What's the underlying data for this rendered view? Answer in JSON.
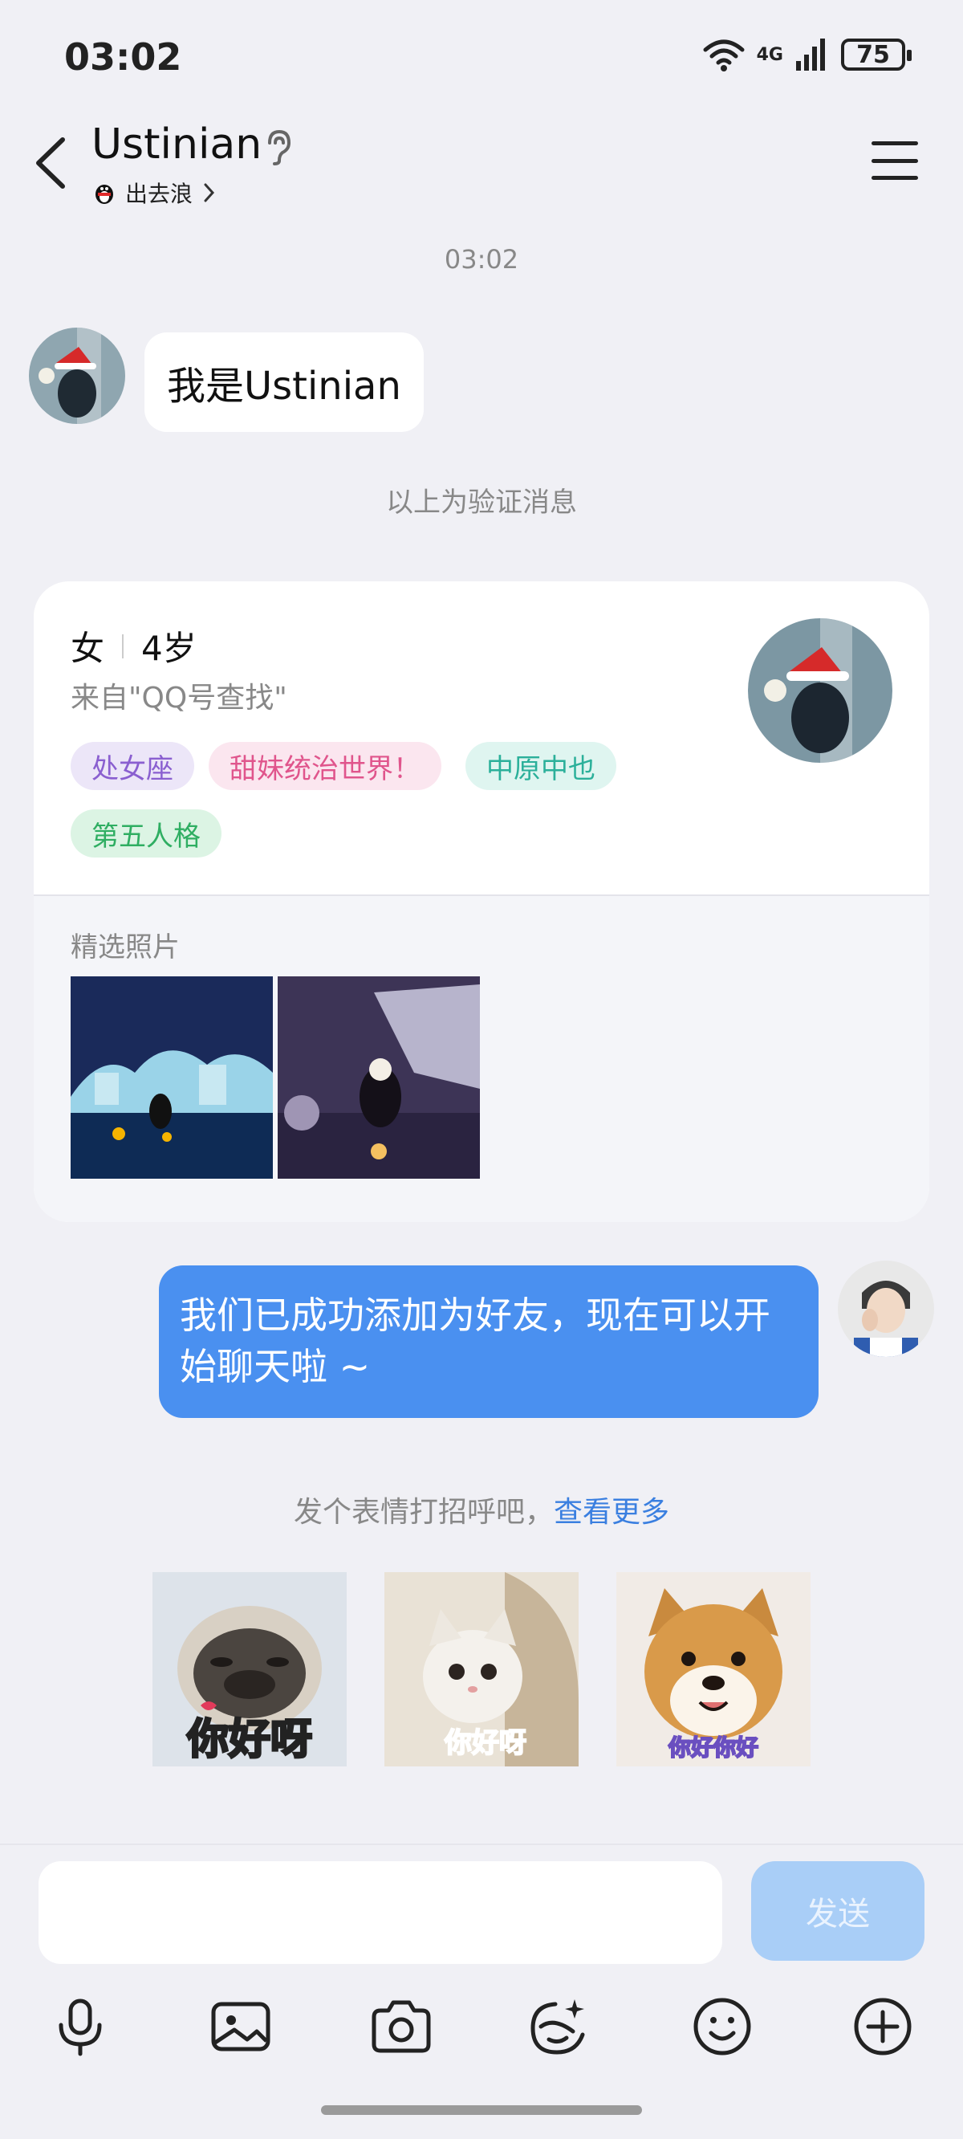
{
  "status_bar": {
    "time": "03:02",
    "network": "4G",
    "battery": "75"
  },
  "header": {
    "title": "Ustinian",
    "subtitle": "出去浪",
    "icons": [
      "back-icon",
      "ear-icon",
      "menu-icon",
      "chevron-right-icon"
    ]
  },
  "chat": {
    "timestamp": "03:02",
    "verification_message": "我是Ustinian",
    "verification_note": "以上为验证消息",
    "friend_message": "我们已成功添加为好友，现在可以开始聊天啦 ~"
  },
  "profile_card": {
    "gender": "女",
    "age": "4岁",
    "source": "来自\"QQ号查找\"",
    "tags": [
      {
        "label": "处女座",
        "bg": "#ece6f8",
        "color": "#8a5fd0"
      },
      {
        "label": "甜妹统治世界！",
        "bg": "#fbe6ef",
        "color": "#e0558c"
      },
      {
        "label": "中原中也",
        "bg": "#dff5f0",
        "color": "#2bb09a"
      },
      {
        "label": "第五人格",
        "bg": "#dcf4e4",
        "color": "#2fae62"
      }
    ],
    "photos_label": "精选照片"
  },
  "greeting": {
    "prompt": "发个表情打招呼吧，",
    "more_link": "查看更多",
    "stickers": [
      "你好呀",
      "你好呀",
      "你好你好"
    ]
  },
  "input_bar": {
    "placeholder": "",
    "send_label": "发送",
    "tools": [
      "microphone-icon",
      "image-icon",
      "camera-icon",
      "sticker-icon",
      "emoji-icon",
      "plus-icon"
    ]
  },
  "colors": {
    "accent": "#4a90f0",
    "send_disabled": "#a9cef7",
    "background": "#f0f0f5"
  }
}
